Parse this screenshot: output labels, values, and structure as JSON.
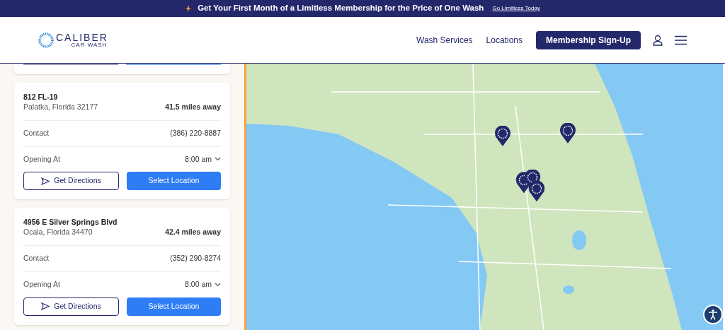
{
  "promo_banner": {
    "text": "Get Your First Month of a Limitless Membership for the Price of One Wash",
    "link": "Go Limitless Today"
  },
  "header": {
    "logo": {
      "name": "CALIBER",
      "tagline": "CAR WASH"
    },
    "nav": [
      "Wash Services",
      "Locations"
    ],
    "cta": "Membership Sign-Up"
  },
  "locations": [
    {
      "street": "812 FL-19",
      "city": "Palatka, Florida 32177",
      "distance": "41.5 miles away",
      "contact_label": "Contact",
      "phone": "(386) 220-8887",
      "hours_label": "Opening At",
      "hours": "8:00 am",
      "directions_button": "Get Directions",
      "select_button": "Select Location"
    },
    {
      "street": "4956 E Silver Springs Blvd",
      "city": "Ocala, Florida 34470",
      "distance": "42.4 miles away",
      "contact_label": "Contact",
      "phone": "(352) 290-8274",
      "hours_label": "Opening At",
      "hours": "8:00 am",
      "directions_button": "Get Directions",
      "select_button": "Select Location"
    }
  ]
}
